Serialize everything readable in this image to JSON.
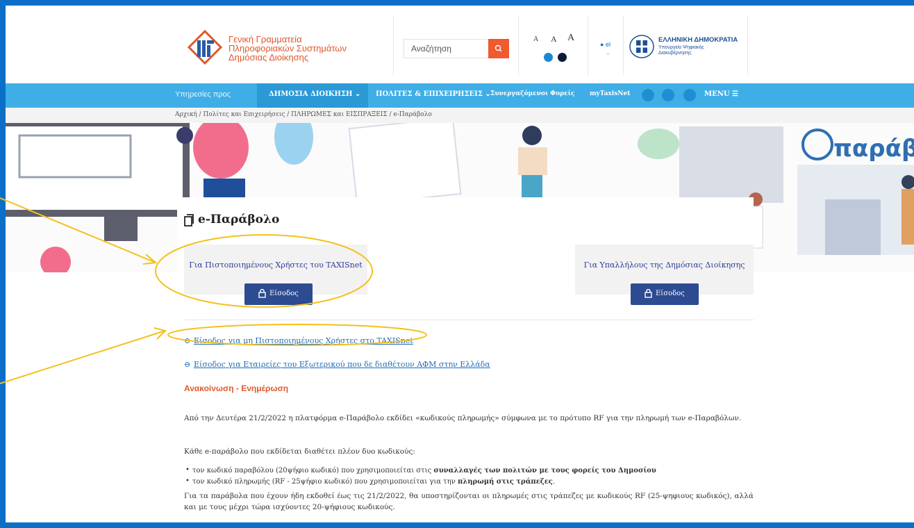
{
  "header": {
    "org_lines": [
      "Γενική Γραμματεία",
      "Πληροφοριακών Συστημάτων",
      "Δημόσιας Διοίκησης"
    ],
    "search_placeholder": "Αναζήτηση",
    "font_sizes": [
      "A",
      "A",
      "A"
    ],
    "language": "el",
    "gov_title": "ΕΛΛΗΝΙΚΗ ΔΗΜΟΚΡΑΤΙΑ",
    "gov_ministry": [
      "Υπουργείο Ψηφιακής",
      "Διακυβέρνησης"
    ]
  },
  "nav": {
    "services_for": "Υπηρεσίες προς",
    "public_admin": "ΔΗΜΟΣΙΑ ΔΙΟΙΚΗΣΗ",
    "citizens": "ΠΟΛΙΤΕΣ & ΕΠΙΧΕΙΡΗΣΕΙΣ",
    "partners": "Συνεργαζόμενοι Φορείς",
    "mytaxisnet": "myTaxisNet",
    "menu": "MENU"
  },
  "breadcrumb": "Αρχική / Πολίτες και Επιχειρήσεις / ΠΛΗΡΩΜΕΣ και ΕΙΣΠΡΑΞΕΙΣ / e-Παράβολο",
  "hero": {
    "brand": "παράβολο"
  },
  "page": {
    "title": "e-Παράβολο",
    "box_left_label": "Για Πιστοποιημένους Χρήστες του TAXISnet",
    "box_right_label": "Για Υπαλλήλους της Δημόσιας Διοίκησης",
    "login_label": "Είσοδος",
    "link_noncertified": "Είσοδος για μη Πιστοποιημένους Χρήστες στο TAXISnet",
    "link_foreign": "Είσοδος για Εταιρείες του Εξωτερικού που δε διαθέτουν ΑΦΜ στην Ελλάδα",
    "announcement_title": "Ανακοίνωση - Ενημέρωση",
    "para1": "Από την Δευτέρα 21/2/2022 η πλατφόρμα e-Παράβολο εκδίδει «κωδικούς πληρωμής» σύμφωνα με το πρότυπο RF για την πληρωμή των e-Παραβόλων.",
    "para2": "Κάθε e-παράβολο που εκδίδεται διαθέτει πλέον δυο κωδικούς:",
    "bullet1_text": "τον κωδικό παραβόλου (20ψήφιο κωδικό) που χρησιμοποιείται στις ",
    "bullet1_bold": "συναλλαγές των πολιτών με τους φορείς του Δημοσίου",
    "bullet2_text": "τον κωδικό πληρωμής (RF - 25ψήφιο κωδικό) που χρησιμοποιείται για την ",
    "bullet2_bold": "πληρωμή στις τράπεζες",
    "bullet2_end": ".",
    "para3": "Για τα παράβολα που έχουν ήδη εκδοθεί έως τις 21/2/2022, θα υποστηρίζονται οι πληρωμές στις τράπεζες με κωδικούς RF (25-ψηφιους κωδικός), αλλά και με τους μέχρι τώρα ισχύοντες 20-ψήφιους κωδικούς."
  },
  "colors": {
    "frame": "#0b6fc7",
    "nav": "#3faee6",
    "accent": "#ef5a2f",
    "button": "#2d4b91",
    "annotation": "#f5c01c"
  }
}
